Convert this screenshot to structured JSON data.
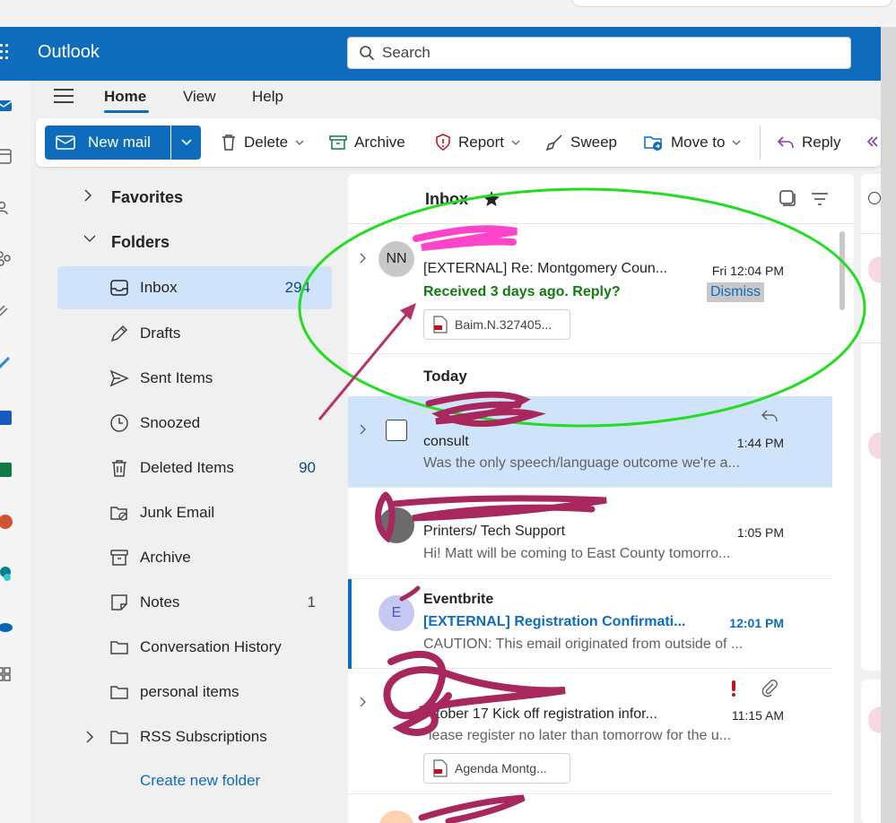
{
  "app": {
    "name": "Outlook"
  },
  "search": {
    "placeholder": "Search"
  },
  "menu": {
    "tabs": [
      {
        "label": "Home"
      },
      {
        "label": "View"
      },
      {
        "label": "Help"
      }
    ]
  },
  "ribbon": {
    "new_mail": "New mail",
    "delete": "Delete",
    "archive": "Archive",
    "report": "Report",
    "sweep": "Sweep",
    "move_to": "Move to",
    "reply": "Reply"
  },
  "folders": {
    "favorites": "Favorites",
    "folders": "Folders",
    "items": [
      {
        "name": "Inbox",
        "count": "294"
      },
      {
        "name": "Drafts",
        "count": ""
      },
      {
        "name": "Sent Items",
        "count": ""
      },
      {
        "name": "Snoozed",
        "count": ""
      },
      {
        "name": "Deleted Items",
        "count": "90"
      },
      {
        "name": "Junk Email",
        "count": ""
      },
      {
        "name": "Archive",
        "count": ""
      },
      {
        "name": "Notes",
        "count": "1"
      },
      {
        "name": "Conversation History",
        "count": ""
      },
      {
        "name": "personal items",
        "count": ""
      },
      {
        "name": "RSS Subscriptions",
        "count": ""
      }
    ],
    "create_new": "Create new folder"
  },
  "list": {
    "title": "Inbox",
    "group_today": "Today",
    "dismiss": "Dismiss",
    "messages": [
      {
        "initials": "NN",
        "subject": "[EXTERNAL] Re: Montgomery Coun...",
        "nudge": "Received 3 days ago. Reply?",
        "time": "Fri 12:04 PM",
        "attachment": "Baim.N.327405..."
      },
      {
        "subject": "consult",
        "preview": "Was the only speech/language outcome we're a...",
        "time": "1:44 PM"
      },
      {
        "subject": "Printers/ Tech Support",
        "preview": "Hi! Matt will be coming to East County tomorro...",
        "time": "1:05 PM"
      },
      {
        "initials": "E",
        "sender": "Eventbrite",
        "subject": "[EXTERNAL] Registration Confirmati...",
        "preview": "CAUTION: This email originated from outside of ...",
        "time": "12:01 PM"
      },
      {
        "subject": "ctober 17 Kick off registration infor...",
        "preview": "lease register no later than tomorrow for the u...",
        "time": "11:15 AM",
        "attachment": "Agenda Montg..."
      }
    ]
  },
  "colors": {
    "brand": "#0f6cbd",
    "selected": "#cfe4fa",
    "nudge": "#107c10",
    "highlight_ring": "#22dd22",
    "annotation_arrow": "#b5336b",
    "redaction": "#a8285e",
    "redaction_pink": "#ff44cc"
  }
}
